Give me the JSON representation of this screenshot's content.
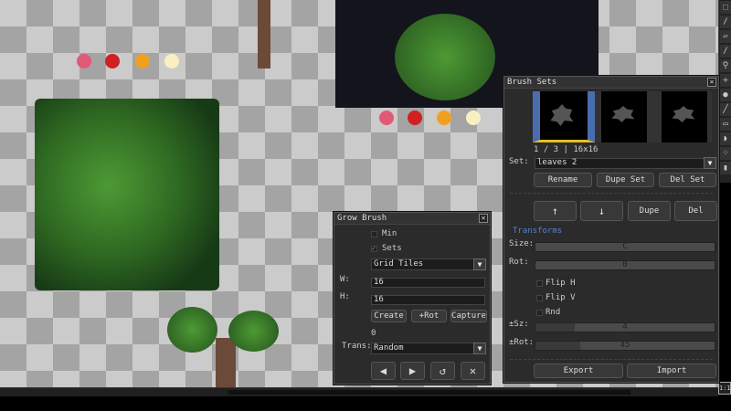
{
  "colors": {
    "accent": "#4a6db0",
    "selection": "#e8c020",
    "transforms_heading": "#5a7fd0"
  },
  "toolbar": {
    "tools": [
      "marquee-icon",
      "brush-icon",
      "eraser-icon",
      "pencil-icon",
      "zoom-icon",
      "move-icon",
      "fill-icon",
      "line-icon",
      "rect-icon",
      "blob-icon",
      "spray-icon",
      "stamp-icon"
    ]
  },
  "zoom_ratio": "1:1",
  "brush_sets": {
    "title": "Brush Sets",
    "counter": "1 / 3  |  16x16",
    "set_label": "Set:",
    "set_value": "leaves 2",
    "rename": "Rename",
    "dupe_set": "Dupe Set",
    "del_set": "Del Set",
    "up": "↑",
    "down": "↓",
    "dupe": "Dupe",
    "del": "Del",
    "transforms": "Transforms",
    "size_label": "Size:",
    "size_value": "C",
    "rot_label": "Rot:",
    "rot_value": "0",
    "flip_h": "Flip H",
    "flip_v": "Flip V",
    "rnd": "Rnd",
    "flip_h_checked": false,
    "flip_v_checked": false,
    "rnd_checked": false,
    "psz_label": "±Sz:",
    "psz_value": "4",
    "psz_fraction": 0.22,
    "prot_label": "±Rot:",
    "prot_value": "45",
    "prot_fraction": 0.25,
    "export": "Export",
    "import": "Import"
  },
  "grow_brush": {
    "title": "Grow Brush",
    "min": "Min",
    "min_checked": false,
    "sets": "Sets",
    "sets_checked": true,
    "mode_value": "Grid Tiles",
    "w_label": "W:",
    "w_value": "16",
    "h_label": "H:",
    "h_value": "16",
    "create": "Create",
    "rot": "+Rot",
    "capture": "Capture",
    "count": "0",
    "trans_label": "Trans:",
    "trans_value": "Random",
    "prev": "◀",
    "next": "▶",
    "reset": "↺",
    "clear": "✕"
  }
}
